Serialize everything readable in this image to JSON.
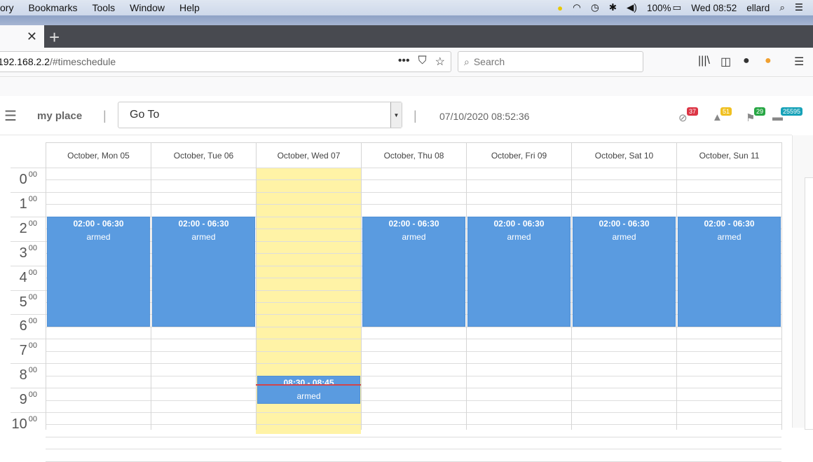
{
  "menubar": {
    "items": [
      "ory",
      "Bookmarks",
      "Tools",
      "Window",
      "Help"
    ],
    "battery": "100%",
    "clock": "Wed 08:52",
    "user": "ellard"
  },
  "browser": {
    "url_host": "192.168.2.2",
    "url_path": "/#timeschedule",
    "search_placeholder": "Search"
  },
  "header": {
    "place": "my place",
    "goto": "Go To",
    "datetime": "07/10/2020 08:52:36",
    "indicators": [
      {
        "icon": "blocked-icon",
        "count": "37",
        "color": "#dc3545"
      },
      {
        "icon": "warning-icon",
        "count": "51",
        "color": "#f0c020"
      },
      {
        "icon": "flag-icon",
        "count": "29",
        "color": "#28a745"
      },
      {
        "icon": "monitor-icon",
        "count": "25595",
        "color": "#17a2b8"
      }
    ]
  },
  "calendar": {
    "days": [
      "October, Mon 05",
      "October, Tue 06",
      "October, Wed 07",
      "October, Thu 08",
      "October, Fri 09",
      "October, Sat 10",
      "October, Sun 11"
    ],
    "today_index": 2,
    "hours": [
      "0",
      "1",
      "2",
      "3",
      "4",
      "5",
      "6",
      "7",
      "8",
      "9",
      "10"
    ],
    "minutes_label": "00",
    "now": "08:52",
    "events": [
      {
        "day": 0,
        "start": "02:00",
        "end": "06:30",
        "time": "02:00 - 06:30",
        "status": "armed"
      },
      {
        "day": 1,
        "start": "02:00",
        "end": "06:30",
        "time": "02:00 - 06:30",
        "status": "armed"
      },
      {
        "day": 2,
        "start": "08:30",
        "end": "08:45",
        "time": "08:30 - 08:45",
        "status": "armed"
      },
      {
        "day": 3,
        "start": "02:00",
        "end": "06:30",
        "time": "02:00 - 06:30",
        "status": "armed"
      },
      {
        "day": 4,
        "start": "02:00",
        "end": "06:30",
        "time": "02:00 - 06:30",
        "status": "armed"
      },
      {
        "day": 5,
        "start": "02:00",
        "end": "06:30",
        "time": "02:00 - 06:30",
        "status": "armed"
      },
      {
        "day": 6,
        "start": "02:00",
        "end": "06:30",
        "time": "02:00 - 06:30",
        "status": "armed"
      }
    ],
    "event_color": "#5a9be0",
    "today_color": "#fff3a6"
  }
}
